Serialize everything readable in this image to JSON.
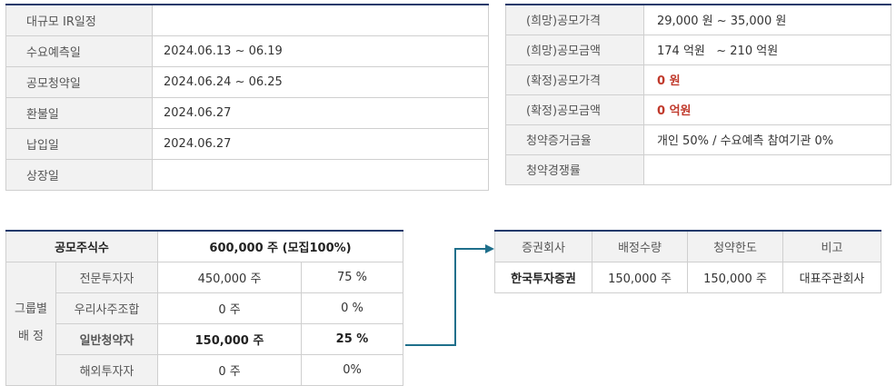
{
  "schedule": {
    "rows": [
      {
        "label": "대규모 IR일정",
        "value": ""
      },
      {
        "label": "수요예측일",
        "value": "2024.06.13 ~ 06.19"
      },
      {
        "label": "공모청약일",
        "value": "2024.06.24 ~ 06.25"
      },
      {
        "label": "환불일",
        "value": "2024.06.27"
      },
      {
        "label": "납입일",
        "value": "2024.06.27"
      },
      {
        "label": "상장일",
        "value": ""
      }
    ]
  },
  "price": {
    "rows": [
      {
        "label": "(희망)공모가격",
        "value": "29,000 원 ~ 35,000 원"
      },
      {
        "label": "(희망)공모금액",
        "value": "174 억원   ~ 210 억원"
      },
      {
        "label": "(확정)공모가격",
        "value": "0 원"
      },
      {
        "label": "(확정)공모금액",
        "value": "0 억원"
      },
      {
        "label": "청약증거금율",
        "value": "개인 50% / 수요예측 참여기관 0%"
      },
      {
        "label": "청약경쟁률",
        "value": ""
      }
    ]
  },
  "allocation": {
    "total_label": "공모주식수",
    "total_value": "600,000 주 (모집100%)",
    "group_label_line1": "그룹별",
    "group_label_line2": "배 정",
    "rows": [
      {
        "label": "전문투자자",
        "shares": "450,000 주",
        "pct": "75 %"
      },
      {
        "label": "우리사주조합",
        "shares": "0 주",
        "pct": "0 %"
      },
      {
        "label": "일반청약자",
        "shares": "150,000 주",
        "pct": "25 %"
      },
      {
        "label": "해외투자자",
        "shares": "0 주",
        "pct": "0%"
      }
    ]
  },
  "underwriter": {
    "headers": [
      "증권회사",
      "배정수량",
      "청약한도",
      "비고"
    ],
    "row": {
      "company": "한국투자증권",
      "allocation": "150,000 주",
      "limit": "150,000 주",
      "note": "대표주관회사"
    }
  },
  "colors": {
    "header_border": "#1f3a6b",
    "arrow": "#1f6f8b",
    "confirmed_value": "#c0392b"
  }
}
